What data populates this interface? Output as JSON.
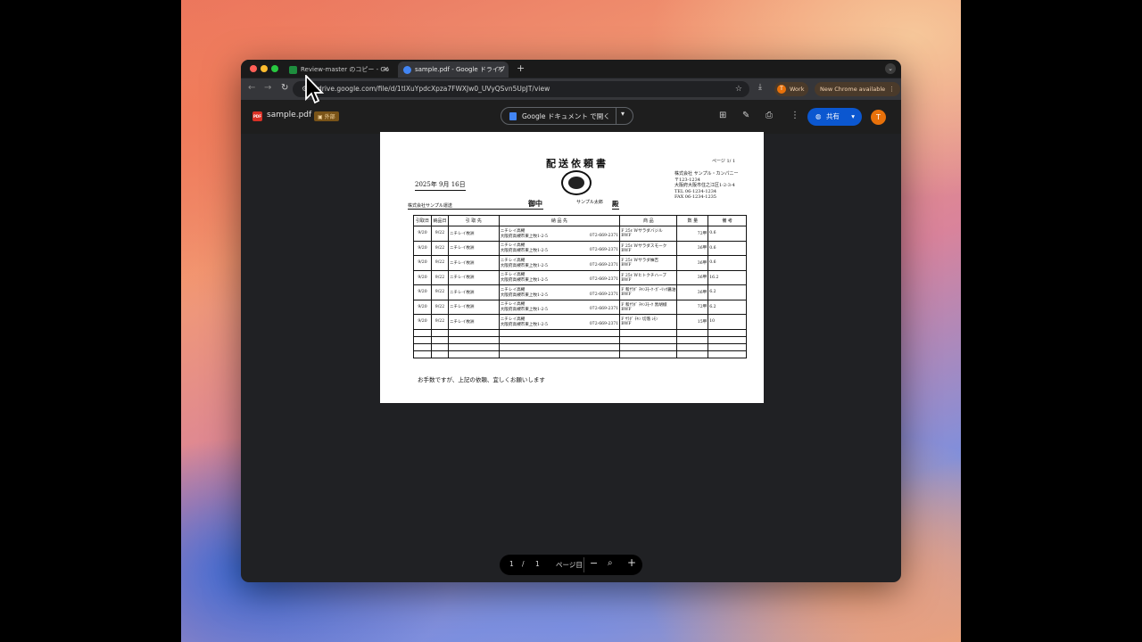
{
  "browser": {
    "tabs": [
      {
        "title": "Review-master のコピー - Go",
        "active": false,
        "favicon_color": "#1e8e3e"
      },
      {
        "title": "sample.pdf - Google ドライブ",
        "active": true,
        "favicon_color": "#4285f4"
      }
    ],
    "new_tab": "+",
    "url": "drive.google.com/file/d/1tIXuYpdcXpza7FWXJw0_UVyQSvn5UpJT/view",
    "profile_label": "Work",
    "profile_initial": "T",
    "update_label": "New Chrome available"
  },
  "drive": {
    "file_name": "sample.pdf",
    "file_badge": "PDF",
    "external_badge": "外部",
    "open_with": "Google ドキュメント で開く",
    "share_label": "共有",
    "avatar_initial": "T"
  },
  "document": {
    "title": "配送依頼書",
    "page_label": "ページ 1/ 1",
    "date": "2025年 9月 16日",
    "company_lines": [
      "株式会社 サンプル・カンパニー",
      "〒123-1234",
      "大阪府大阪市住之江区1-2-3-4",
      "TEL 06-1234-1234",
      "FAX 06-1234-1235"
    ],
    "customer": "株式会社サンプル運送",
    "honorific": "御中",
    "recipient_person": "サンプル太郎",
    "recipient_honorific": "殿",
    "headers": [
      "引取日",
      "納品日",
      "引 取 先",
      "納 品 先",
      "商 品",
      "数 量",
      "備 考"
    ],
    "rows": [
      {
        "pickup": "9/20",
        "delivery": "9/22",
        "source": "ニチレイ枚洲",
        "dest_name": "ニチレイ高槻",
        "dest_addr": "大阪府高槻市東上牧1-2-5",
        "dest_tel": "072-669-2371",
        "product": "F 25ℓ Wサラダバジル",
        "product_sub": "BWF",
        "qty": "72甲",
        "note": "0.6"
      },
      {
        "pickup": "9/20",
        "delivery": "9/22",
        "source": "ニチレイ枚洲",
        "dest_name": "ニチレイ高槻",
        "dest_addr": "大阪府高槻市東上牧1-2-5",
        "dest_tel": "072-669-2371",
        "product": "F 25ℓ Wサラダスモーク",
        "product_sub": "BWF",
        "qty": "36甲",
        "note": "0.6"
      },
      {
        "pickup": "9/20",
        "delivery": "9/22",
        "source": "ニチレイ枚洲",
        "dest_name": "ニチレイ高槻",
        "dest_addr": "大阪府高槻市東上牧1-2-5",
        "dest_tel": "072-669-2371",
        "product": "F 25ℓ Wサラダ柚吉",
        "product_sub": "BWF",
        "qty": "36甲",
        "note": "0.6"
      },
      {
        "pickup": "9/20",
        "delivery": "9/22",
        "source": "ニチレイ枚洲",
        "dest_name": "ニチレイ高槻",
        "dest_addr": "大阪府高槻市東上牧1-2-5",
        "dest_tel": "072-669-2371",
        "product": "F 25ℓ Wヒトクチハーブ",
        "product_sub": "BWF",
        "qty": "36甲",
        "note": "16.2"
      },
      {
        "pickup": "9/20",
        "delivery": "9/22",
        "source": "ニチレイ枚洲",
        "dest_name": "ニチレイ高槻",
        "dest_addr": "大阪府高槻市東上牧1-2-5",
        "dest_tel": "072-669-2371",
        "product": "F 和ｻﾗﾀﾞ ﾁｷﾝｽﾓｰｸ･ｶﾞｰﾘｯｸ醤油",
        "product_sub": "BWF",
        "qty": "36甲",
        "note": "6.2"
      },
      {
        "pickup": "9/20",
        "delivery": "9/22",
        "source": "ニチレイ枚洲",
        "dest_name": "ニチレイ高槻",
        "dest_addr": "大阪府高槻市東上牧1-2-5",
        "dest_tel": "072-669-2371",
        "product": "F 和ｻﾗﾀﾞ ﾁｷﾝｽﾓｰｸ 黒胡椒",
        "product_sub": "BWF",
        "qty": "72甲",
        "note": "6.2"
      },
      {
        "pickup": "9/20",
        "delivery": "9/22",
        "source": "ニチレイ枚洲",
        "dest_name": "ニチレイ高槻",
        "dest_addr": "大阪府高槻市東上牧1-2-5",
        "dest_tel": "072-669-2371",
        "product": "F ｻﾗﾀﾞ ﾁｷﾝ 切落 ﾚﾓﾝ",
        "product_sub": "BWF",
        "qty": "15甲",
        "note": "10"
      }
    ],
    "footer_note": "お手数ですが、上記の依頼、宜しくお願いします"
  },
  "pager": {
    "current": "1",
    "separator": "/",
    "total": "1",
    "unit": "ページ目"
  }
}
